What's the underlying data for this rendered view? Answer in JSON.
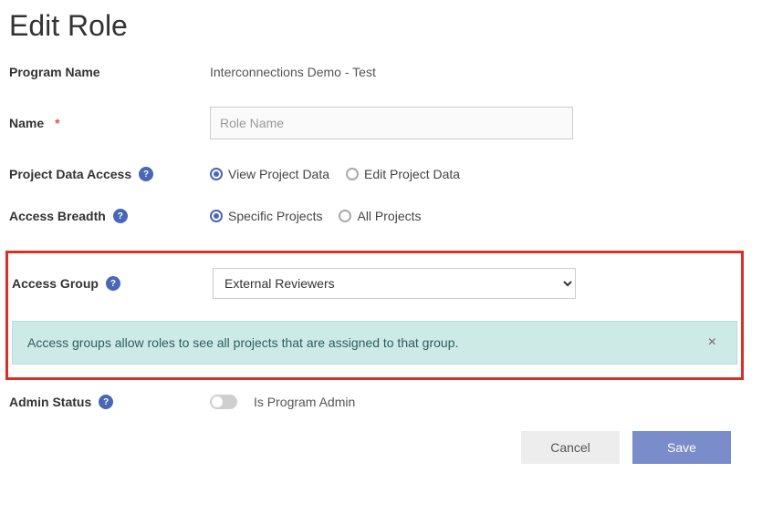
{
  "title": "Edit Role",
  "fields": {
    "program_name": {
      "label": "Program Name",
      "value": "Interconnections Demo - Test"
    },
    "name": {
      "label": "Name",
      "placeholder": "Role Name",
      "value": ""
    },
    "project_data_access": {
      "label": "Project Data Access",
      "options": {
        "view": "View Project Data",
        "edit": "Edit Project Data"
      },
      "selected": "view"
    },
    "access_breadth": {
      "label": "Access Breadth",
      "options": {
        "specific": "Specific Projects",
        "all": "All Projects"
      },
      "selected": "specific"
    },
    "access_group": {
      "label": "Access Group",
      "selected": "External Reviewers"
    },
    "admin_status": {
      "label": "Admin Status",
      "toggle_label": "Is Program Admin",
      "on": false
    }
  },
  "info_banner": {
    "text": "Access groups allow roles to see all projects that are assigned to that group."
  },
  "buttons": {
    "cancel": "Cancel",
    "save": "Save"
  }
}
